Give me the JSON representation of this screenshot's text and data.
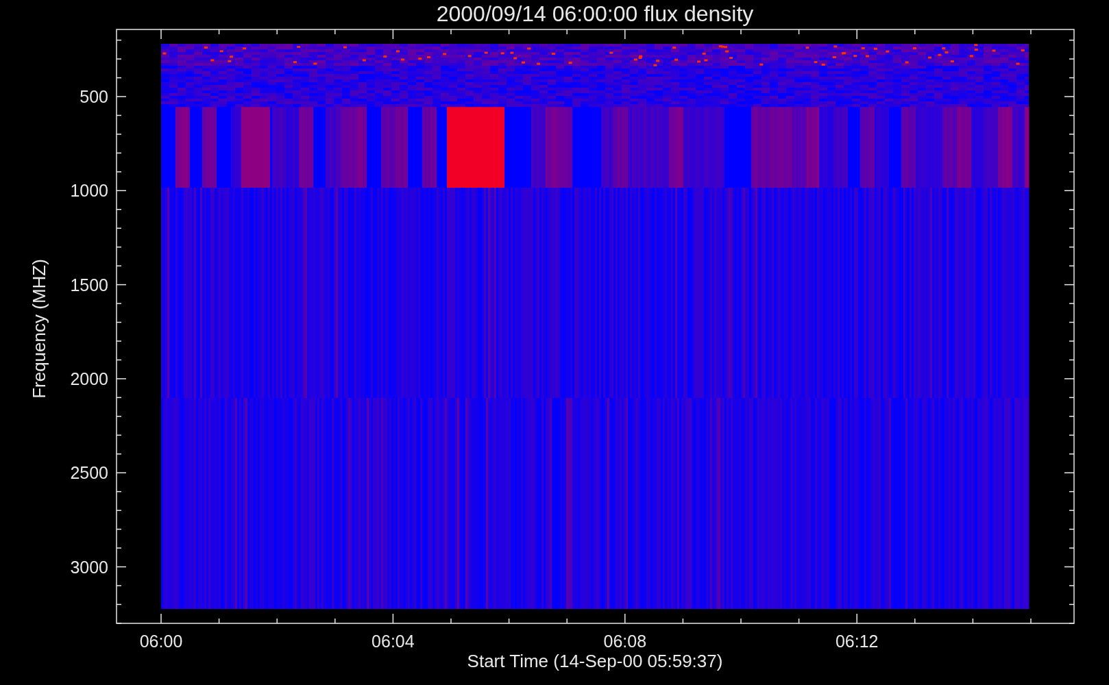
{
  "title": "2000/09/14 06:00:00 flux density",
  "y_axis": {
    "label": "Frequency (MHZ)",
    "ticks": [
      "500",
      "1000",
      "1500",
      "2000",
      "2500",
      "3000"
    ]
  },
  "x_axis": {
    "label": "Start Time (14-Sep-00 05:59:37)",
    "ticks": [
      "06:00",
      "06:04",
      "06:08",
      "06:12"
    ]
  }
}
